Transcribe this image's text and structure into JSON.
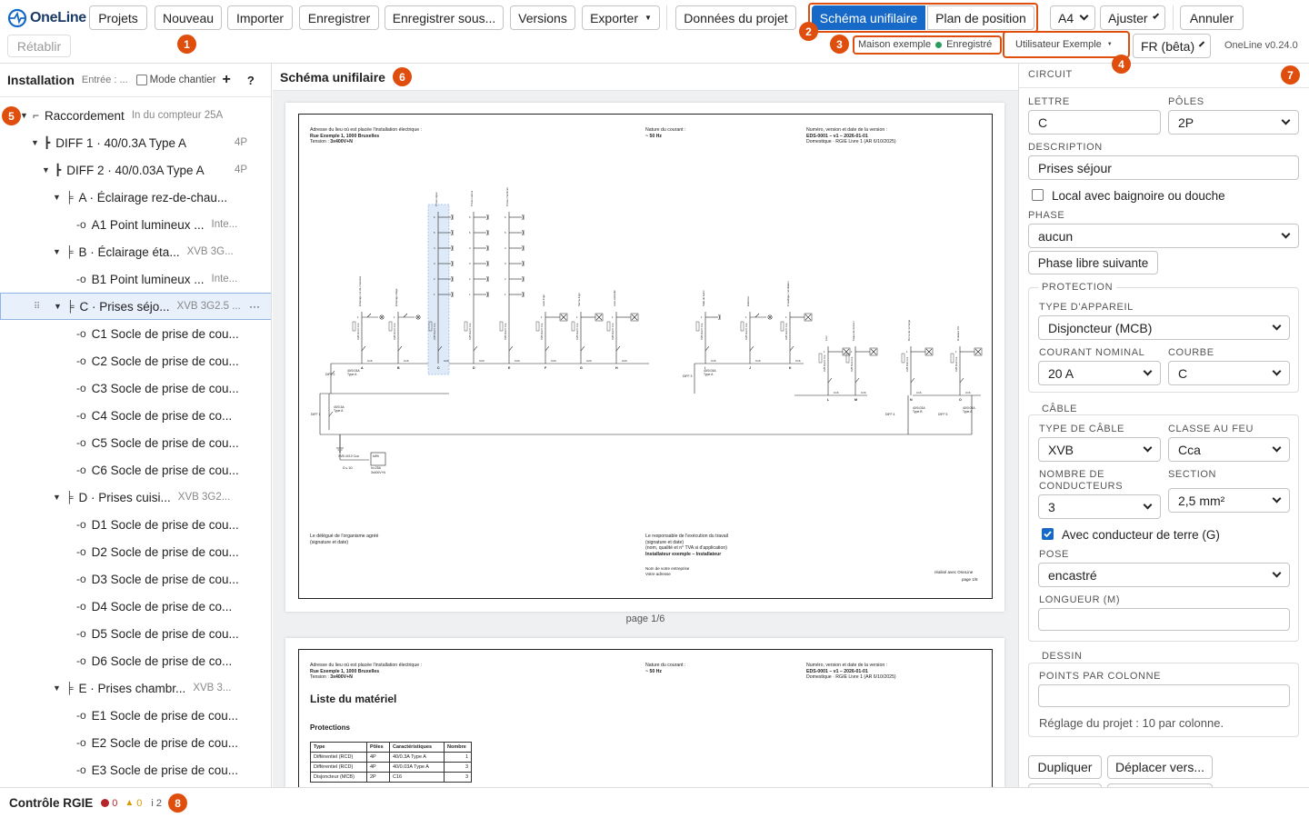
{
  "app": {
    "logo_text": "OneLine",
    "version": "OneLine v0.24.0"
  },
  "toolbar": {
    "projets": "Projets",
    "nouveau": "Nouveau",
    "importer": "Importer",
    "enregistrer": "Enregistrer",
    "enregistrer_sous": "Enregistrer sous...",
    "versions": "Versions",
    "exporter": "Exporter",
    "donnees": "Données du projet",
    "schema": "Schéma unifilaire",
    "plan": "Plan de position",
    "format": "A4",
    "ajuster": "Ajuster",
    "annuler": "Annuler",
    "retablir": "Rétablir",
    "project_name": "Maison exemple",
    "saved_status": "Enregistré",
    "user": "Utilisateur Exemple",
    "lang": "FR (bêta)"
  },
  "badges": {
    "b1": "1",
    "b2": "2",
    "b3": "3",
    "b4": "4",
    "b5": "5",
    "b6": "6",
    "b7": "7",
    "b8": "8"
  },
  "colors": {
    "accent": "#1769c7",
    "badge": "#e04e0d",
    "ok": "#2a9d5c",
    "error": "#b5262a",
    "warn": "#d99a00"
  },
  "sidebar": {
    "title": "Installation",
    "entry": "Entrée : ...",
    "mode_chantier": "Mode chantier",
    "add": "+",
    "help": "?",
    "items": [
      {
        "label": "Raccordement",
        "meta": "In du compteur 25A"
      },
      {
        "label": "DIFF 1 · 40/0.3A Type A",
        "meta": "4P"
      },
      {
        "label": "DIFF 2 · 40/0.03A Type A",
        "meta": "4P"
      },
      {
        "label": "A · Éclairage rez-de-chau...",
        "meta": ""
      },
      {
        "label": "A1 Point lumineux ...",
        "meta": "Inte..."
      },
      {
        "label": "B · Éclairage éta...",
        "meta": "XVB 3G..."
      },
      {
        "label": "B1 Point lumineux ...",
        "meta": "Inte..."
      },
      {
        "label": "C · Prises séjo...",
        "meta": "XVB 3G2.5 ..."
      },
      {
        "label": "C1 Socle de prise de cou...",
        "meta": ""
      },
      {
        "label": "C2 Socle de prise de cou...",
        "meta": ""
      },
      {
        "label": "C3 Socle de prise de cou...",
        "meta": ""
      },
      {
        "label": "C4 Socle de prise de co...",
        "meta": ""
      },
      {
        "label": "C5 Socle de prise de cou...",
        "meta": ""
      },
      {
        "label": "C6 Socle de prise de cou...",
        "meta": ""
      },
      {
        "label": "D · Prises cuisi...",
        "meta": "XVB 3G2..."
      },
      {
        "label": "D1 Socle de prise de cou...",
        "meta": ""
      },
      {
        "label": "D2 Socle de prise de cou...",
        "meta": ""
      },
      {
        "label": "D3 Socle de prise de cou...",
        "meta": ""
      },
      {
        "label": "D4 Socle de prise de co...",
        "meta": ""
      },
      {
        "label": "D5 Socle de prise de cou...",
        "meta": ""
      },
      {
        "label": "D6 Socle de prise de co...",
        "meta": ""
      },
      {
        "label": "E · Prises chambr...",
        "meta": "XVB 3..."
      },
      {
        "label": "E1 Socle de prise de cou...",
        "meta": ""
      },
      {
        "label": "E2 Socle de prise de cou...",
        "meta": ""
      },
      {
        "label": "E3 Socle de prise de cou...",
        "meta": ""
      }
    ],
    "more": "···"
  },
  "main": {
    "title": "Schéma unifilaire",
    "page_label": "page 1/6",
    "sheet": {
      "addr_label": "Adresse du lieu où est placée l'installation électrique :",
      "addr": "Rue Exemple 1, 1000 Bruxelles",
      "tension_label": "Tension :",
      "tension": "3x400V+N",
      "courant_label": "Nature du courant :",
      "courant": "~ 50 Hz",
      "numero_label": "Numéro, version et date de la version :",
      "numero": "EDS-0001 – v1 – 2026-01-01",
      "domestique": "Domestique · RGIE Livre 1 (AR 6/10/2025)",
      "delegue": "Le délégué de l'organisme agréé",
      "delegue_sub": "(signature et date)",
      "resp": "Le responsable de l'exécution du travail",
      "resp_sub": "(signature et date)",
      "resp_sub2": "(nom, qualité et n° TVA si d'application)",
      "resp_name": "Installateur exemple – Installateur",
      "resp_ent": "Nom de votre entreprise",
      "resp_adr": "Votre adresse",
      "realise": "réalisé avec OneLine",
      "page_of": "page 1/6",
      "diff1": "DIFF 1",
      "diff1_spec": "40/0.3A",
      "diff1_type": "Type A",
      "diff2": "DIFF 2",
      "diff2_spec": "40/0.03A",
      "diff2_type": "Type A",
      "diff3": "DIFF 3",
      "diff3_spec": "40/0.03A",
      "diff3_type": "Type A",
      "diff4": "DIFF 4",
      "diff4_spec": "40/0.03A",
      "diff4_type": "Type B",
      "diff5": "DIFF 5",
      "diff5_spec": "40/0.03A",
      "diff5_type": "Type A",
      "compteur": "kWh",
      "compteur_spec": "In=25A",
      "compteur_tension": "3x400V+N",
      "cable_main": "XVB 4X10 Cca",
      "terre": "Ω ≤ 1Ω",
      "circuits": [
        {
          "letter": "A",
          "rot": "Éclairage rez-de-chaussée",
          "protect": "C16",
          "cable": "XVB 3G1.5 Cca",
          "n": 1,
          "sym": "lamp"
        },
        {
          "letter": "B",
          "rot": "Éclairage étage",
          "protect": "C16",
          "cable": "XVB 3G1.5 Cca",
          "n": 1,
          "sym": "lamp"
        },
        {
          "letter": "C",
          "rot": "Prises séjour",
          "protect": "C20",
          "cable": "XVB 3G2.5 Cca",
          "n": 6,
          "sym": "socket"
        },
        {
          "letter": "D",
          "rot": "Prises cuisine",
          "protect": "C20",
          "cable": "XVB 3G2.5 Cca",
          "n": 6,
          "sym": "socket"
        },
        {
          "letter": "E",
          "rot": "Prises chambres",
          "protect": "C20",
          "cable": "XVB 3G2.5 Cca",
          "n": 6,
          "sym": "socket"
        },
        {
          "letter": "F",
          "rot": "Lave-linge",
          "protect": "C20",
          "cable": "XVB 3G2.5 Cca",
          "n": 1,
          "sym": "box"
        },
        {
          "letter": "G",
          "rot": "Sèche-linge",
          "protect": "C20",
          "cable": "XVB 3G2.5 Cca",
          "n": 1,
          "sym": "box"
        },
        {
          "letter": "H",
          "rot": "Lave-vaisselle",
          "protect": "C20",
          "cable": "XVB 3G2.5 Cca",
          "n": 1,
          "sym": "box"
        },
        {
          "letter": "I",
          "rot": "Salle de bains",
          "protect": "C16",
          "cable": "XVB 3G2.5 Cca",
          "n": 1,
          "sym": "socket"
        },
        {
          "letter": "J",
          "rot": "Extérieur",
          "protect": "C16",
          "cable": "XVB 3G2.5 Cca",
          "n": 1,
          "sym": "lamp"
        },
        {
          "letter": "K",
          "rot": "Chauffage / ventilation",
          "protect": "C16",
          "cable": "XVB 3G2.5 Cca",
          "n": 1,
          "sym": "box"
        },
        {
          "letter": "L",
          "rot": "Four",
          "protect": "C16",
          "cable": "XVB 3G2.5 Cca",
          "n": 1,
          "sym": "box"
        },
        {
          "letter": "M",
          "rot": "Taque de cuisson",
          "protect": "C16",
          "cable": "XVB 5G4 Cca",
          "n": 1,
          "sym": "box"
        },
        {
          "letter": "N",
          "rot": "Borne de recharge",
          "protect": "C16",
          "cable": "XVB 3G6 Cca",
          "n": 1,
          "sym": "box"
        },
        {
          "letter": "O",
          "rot": "Onduleur PV",
          "protect": "C16",
          "cable": "XVB 3G4 Cca",
          "n": 1,
          "sym": "box"
        }
      ]
    },
    "sheet2": {
      "title": "Liste du matériel",
      "section": "Protections",
      "headers": [
        "Type",
        "Pôles",
        "Caractéristiques",
        "Nombre"
      ],
      "rows": [
        [
          "Différentiel (RCD)",
          "4P",
          "40/0.3A Type A",
          "1"
        ],
        [
          "Différentiel (RCD)",
          "4P",
          "40/0.03A Type A",
          "3"
        ],
        [
          "Disjoncteur (MCB)",
          "2P",
          "C16",
          "3"
        ]
      ]
    }
  },
  "panel": {
    "circuit": "CIRCUIT",
    "lettre_label": "LETTRE",
    "lettre": "C",
    "poles_label": "PÔLES",
    "poles": "2P",
    "description_label": "DESCRIPTION",
    "description": "Prises séjour",
    "bath_label": "Local avec baignoire ou douche",
    "phase_label": "PHASE",
    "phase": "aucun",
    "phase_btn": "Phase libre suivante",
    "protection": "PROTECTION",
    "type_app_label": "TYPE D'APPAREIL",
    "type_app": "Disjoncteur (MCB)",
    "courant_label": "COURANT NOMINAL",
    "courant": "20 A",
    "courbe_label": "COURBE",
    "courbe": "C",
    "cable": "CÂBLE",
    "type_cable_label": "TYPE DE CÂBLE",
    "type_cable": "XVB",
    "classe_feu_label": "CLASSE AU FEU",
    "classe_feu": "Cca",
    "nb_cond_label": "NOMBRE DE CONDUCTEURS",
    "nb_cond": "3",
    "section_label": "SECTION",
    "section": "2,5 mm²",
    "terre_label": "Avec conducteur de terre (G)",
    "pose_label": "POSE",
    "pose": "encastré",
    "longueur_label": "LONGUEUR (M)",
    "longueur": "",
    "dessin": "DESSIN",
    "points_label": "POINTS PAR COLONNE",
    "points": "",
    "reglage": "Réglage du projet : 10 par colonne.",
    "dupliquer": "Dupliquer",
    "deplacer": "Déplacer vers..."
  },
  "footer": {
    "title": "Contrôle RGIE",
    "errors": "0",
    "warnings": "0",
    "info": "i 2"
  }
}
